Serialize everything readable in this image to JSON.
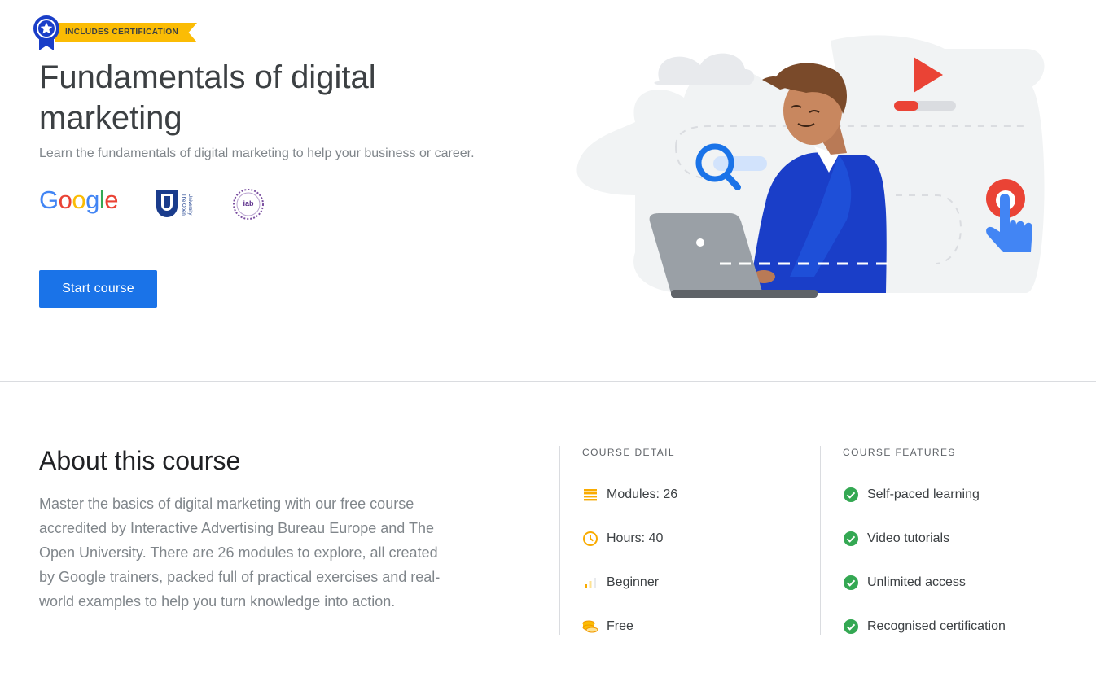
{
  "hero": {
    "badge": "INCLUDES CERTIFICATION",
    "title": "Fundamentals of digital marketing",
    "subtitle": "Learn the fundamentals of digital marketing to help your business or career.",
    "partners": [
      {
        "name": "Google",
        "icon": "google-logo"
      },
      {
        "name": "The Open University",
        "icon": "open-university-logo"
      },
      {
        "name": "iab",
        "icon": "iab-logo"
      }
    ],
    "start_button": "Start course"
  },
  "about": {
    "title": "About this course",
    "body": "Master the basics of digital marketing with our free course accredited by Interactive Advertising Bureau Europe and The Open University. There are 26 modules to explore, all created by Google trainers, packed full of practical exercises and real-world examples to help you turn knowledge into action."
  },
  "course_detail": {
    "heading": "COURSE DETAIL",
    "items": [
      {
        "label": "Modules: 26",
        "icon": "modules-icon"
      },
      {
        "label": "Hours: 40",
        "icon": "clock-icon"
      },
      {
        "label": "Beginner",
        "icon": "level-bars-icon"
      },
      {
        "label": "Free",
        "icon": "coins-icon"
      }
    ]
  },
  "course_features": {
    "heading": "COURSE FEATURES",
    "items": [
      {
        "label": "Self-paced learning",
        "icon": "check-circle-icon"
      },
      {
        "label": "Video tutorials",
        "icon": "check-circle-icon"
      },
      {
        "label": "Unlimited access",
        "icon": "check-circle-icon"
      },
      {
        "label": "Recognised certification",
        "icon": "check-circle-icon"
      }
    ]
  },
  "colors": {
    "primary_blue": "#1a73e8",
    "google_yellow": "#fbbc04",
    "google_red": "#ea4335",
    "google_green": "#34a853",
    "muted_text": "#80868b"
  }
}
